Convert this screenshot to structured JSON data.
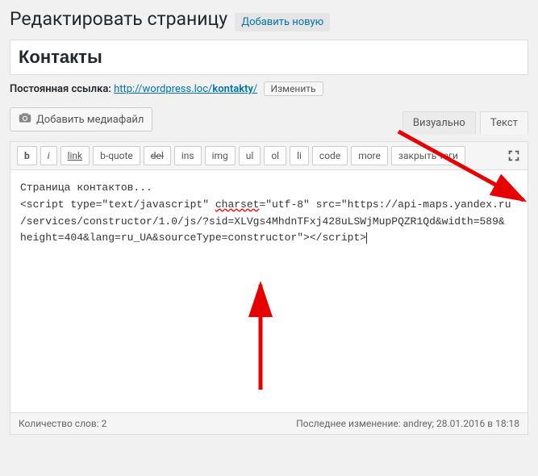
{
  "heading": {
    "title": "Редактировать страницу",
    "add_new": "Добавить новую"
  },
  "post": {
    "title": "Контакты"
  },
  "permalink": {
    "label": "Постоянная ссылка:",
    "base": "http://wordpress.loc/",
    "slug": "kontakty",
    "after": "/",
    "edit_btn": "Изменить"
  },
  "media_btn": "Добавить медиафайл",
  "tabs": {
    "visual": "Визуально",
    "text": "Текст"
  },
  "quicktags": {
    "b": "b",
    "i": "i",
    "link": "link",
    "bquote": "b-quote",
    "del": "del",
    "ins": "ins",
    "img": "img",
    "ul": "ul",
    "ol": "ol",
    "li": "li",
    "code": "code",
    "more": "more",
    "close": "закрыть теги"
  },
  "content": {
    "line1": "Страница контактов...",
    "line2a": "<script type=\"text/javascript\" ",
    "line2b": "charset",
    "line2c": "=\"utf-8\" src=\"https://api-maps.yandex.ru",
    "line3": "/services/constructor/1.0/js/?sid=XLVgs4MhdnTFxj428uLSWjMupPQZR1Qd&width=589&",
    "line4": "height=404&lang=ru_UA&sourceType=constructor\"></script>"
  },
  "status": {
    "word_count_label": "Количество слов:",
    "word_count": "2",
    "last_edit_label": "Последнее изменение:",
    "last_edit_by": "andrey",
    "last_edit_date": "28.01.2016 в 18:18"
  }
}
